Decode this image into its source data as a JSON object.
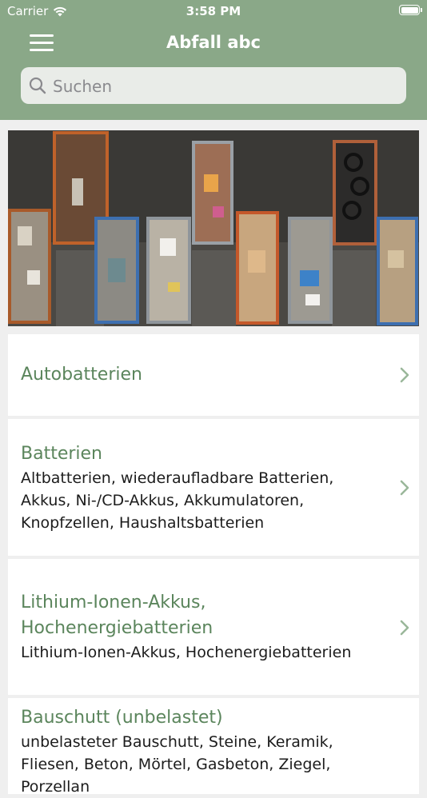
{
  "colors": {
    "accent": "#8aa888",
    "title": "#5b855c",
    "chevron": "#9ab79a"
  },
  "status_bar": {
    "carrier": "Carrier",
    "time": "3:58 PM"
  },
  "header": {
    "title": "Abfall abc"
  },
  "search": {
    "placeholder": "Suchen"
  },
  "hero_image": {
    "icon": "aerial-dumpsters-photo"
  },
  "items": [
    {
      "title": "Autobatterien",
      "subtitle": ""
    },
    {
      "title": "Batterien",
      "subtitle": "Altbatterien, wiederaufladbare Batterien, Akkus, Ni-/CD-Akkus, Akkumulatoren, Knopfzellen, Haushaltsbatterien"
    },
    {
      "title": "Lithium-Ionen-Akkus, Hochenergiebatterien",
      "subtitle": "Lithium-Ionen-Akkus, Hochenergiebatterien"
    },
    {
      "title": "Bauschutt (unbelastet)",
      "subtitle": "unbelasteter Bauschutt, Steine, Keramik, Fliesen, Beton, Mörtel, Gasbeton, Ziegel, Porzellan"
    }
  ]
}
